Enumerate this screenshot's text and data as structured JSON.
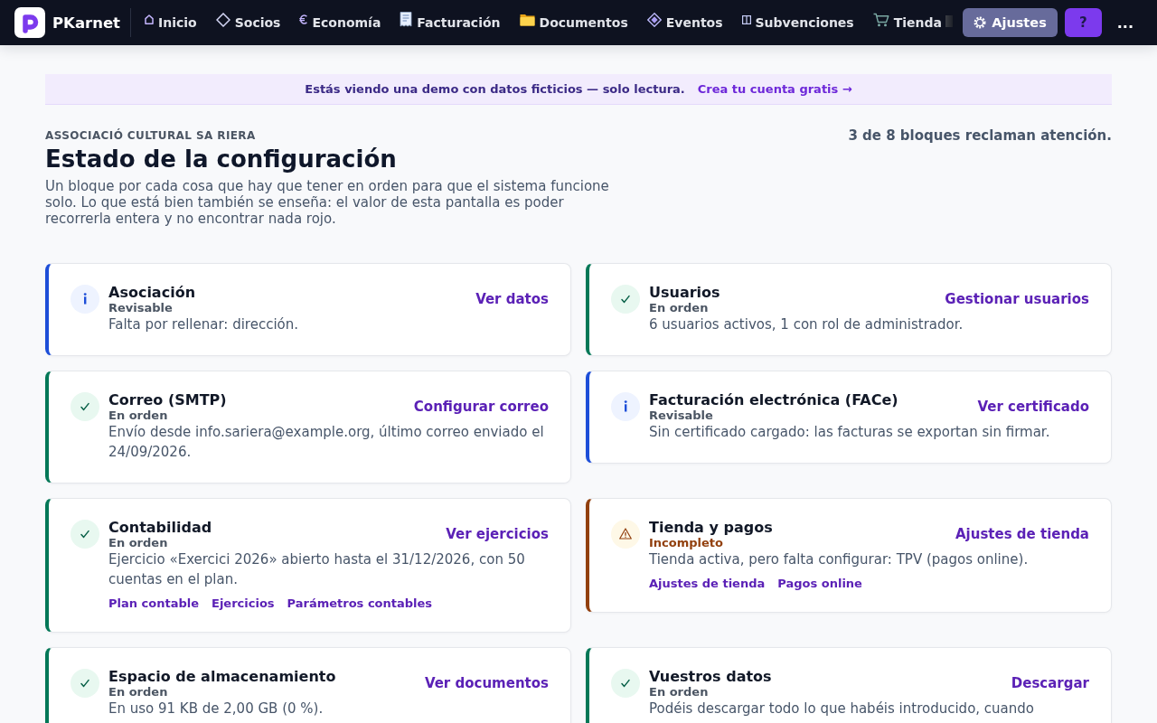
{
  "nav": {
    "brand": "PKarnet",
    "items": [
      {
        "label": "Inicio",
        "selected": false
      },
      {
        "label": "Socios",
        "selected": false
      },
      {
        "label": "Economía",
        "selected": false
      },
      {
        "label": "Facturación",
        "selected": false
      },
      {
        "label": "Documentos",
        "selected": false
      },
      {
        "label": "Eventos",
        "selected": false
      },
      {
        "label": "Subvenciones",
        "selected": false
      },
      {
        "label": "Tienda",
        "selected": false
      }
    ],
    "settings": {
      "label": "Ajustes",
      "selected": true
    },
    "help": "?",
    "more": "..."
  },
  "banner": {
    "text": "Estás viendo una demo con datos ficticios — solo lectura.",
    "link": "Crea tu cuenta gratis →"
  },
  "header": {
    "organization": "ASSOCIACIÓ CULTURAL SA RIERA",
    "title": "Estado de la configuración",
    "description": "Un bloque por cada cosa que hay que tener en orden para que el sistema funcione solo. Lo que está bien también se enseña: el valor de esta pantalla es poder recorrerla entera y no encontrar nada rojo.",
    "summary": "3 de 8 bloques reclaman atención."
  },
  "blocks": [
    {
      "kind": "review",
      "title": "Asociación",
      "status": "Revisable",
      "description": "Falta por rellenar: dirección.",
      "action": "Ver datos"
    },
    {
      "kind": "ok",
      "title": "Usuarios",
      "status": "En orden",
      "description": "6 usuarios activos, 1 con rol de administrador.",
      "action": "Gestionar usuarios"
    },
    {
      "kind": "ok",
      "title": "Correo (SMTP)",
      "status": "En orden",
      "description": "Envío desde info.sariera@example.org, último correo enviado el 24/09/2026.",
      "action": "Configurar correo"
    },
    {
      "kind": "review",
      "title": "Facturación electrónica (FACe)",
      "status": "Revisable",
      "description": "Sin certificado cargado: las facturas se exportan sin firmar.",
      "action": "Ver certificado"
    },
    {
      "kind": "ok",
      "title": "Contabilidad",
      "status": "En orden",
      "description": "Ejercicio «Exercici 2026» abierto hasta el 31/12/2026, con 50 cuentas en el plan.",
      "action": "Ver ejercicios",
      "links": [
        "Plan contable",
        "Ejercicios",
        "Parámetros contables"
      ]
    },
    {
      "kind": "incomplete",
      "title": "Tienda y pagos",
      "status": "Incompleto",
      "description": "Tienda activa, pero falta configurar: TPV (pagos online).",
      "action": "Ajustes de tienda",
      "links": [
        "Ajustes de tienda",
        "Pagos online"
      ]
    },
    {
      "kind": "ok",
      "title": "Espacio de almacenamiento",
      "status": "En orden",
      "description": "En uso 91 KB de 2,00 GB (0 %).",
      "action": "Ver documentos"
    },
    {
      "kind": "ok",
      "title": "Vuestros datos",
      "status": "En orden",
      "description": "Podéis descargar todo lo que habéis introducido, cuando",
      "action": "Descargar"
    }
  ]
}
